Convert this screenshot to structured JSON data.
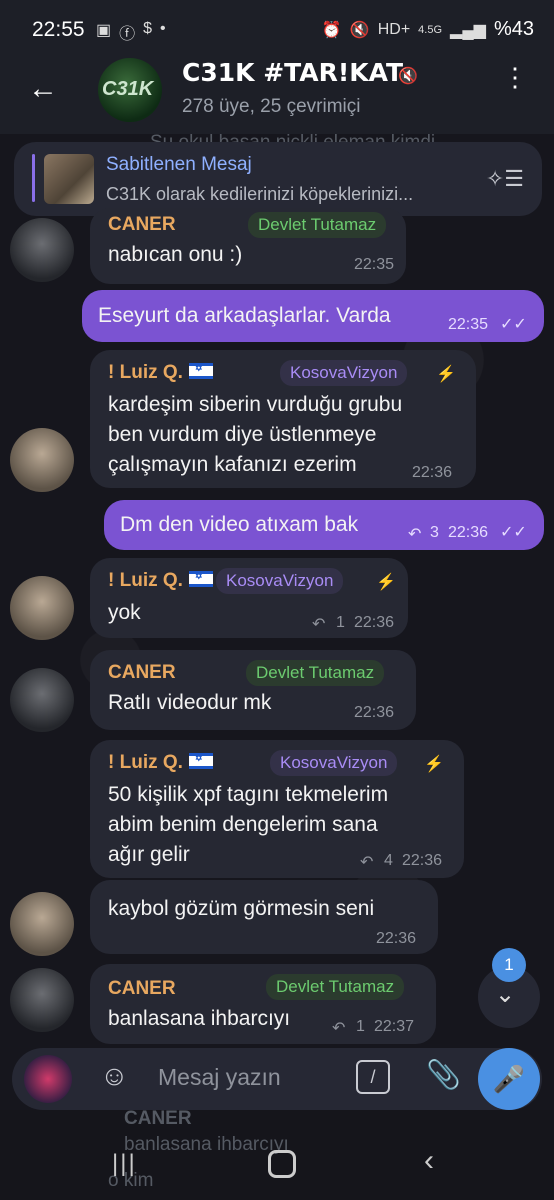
{
  "status": {
    "time": "22:55",
    "network": "4.5G",
    "battery": "%43"
  },
  "header": {
    "title": "C31K #TAR!KAT",
    "subtitle": "278 üye, 25 çevrimiçi",
    "avatar_text": "C31K"
  },
  "pinned": {
    "title": "Sabitlenen Mesaj",
    "text": "C31K olarak kedilerinizi köpeklerinizi..."
  },
  "overlap_text": "Şu okul başan nickli eleman kimdi",
  "messages": [
    {
      "sender": "CANER",
      "tag": "Devlet Tutamaz",
      "text": "nabıcan onu :)",
      "time": "22:35"
    },
    {
      "text": "Eseyurt da arkadaşlarlar. Varda",
      "time": "22:35"
    },
    {
      "sender": "! Luiz Q.",
      "tag": "KosovaVizyon",
      "text": [
        "kardeşim siberin vurduğu grubu",
        "ben vurdum diye üstlenmeye",
        "çalışmayın kafanızı ezerim"
      ],
      "time": "22:36"
    },
    {
      "text": "Dm den video atıxam bak",
      "replies": "3",
      "time": "22:36"
    },
    {
      "sender": "! Luiz Q.",
      "tag": "KosovaVizyon",
      "text": "yok",
      "replies": "1",
      "time": "22:36"
    },
    {
      "sender": "CANER",
      "tag": "Devlet Tutamaz",
      "text": "Ratlı videodur mk",
      "time": "22:36"
    },
    {
      "sender": "! Luiz Q.",
      "tag": "KosovaVizyon",
      "text": [
        "50 kişilik xpf tagını tekmelerim",
        "abim benim dengelerim sana",
        "ağır gelir"
      ],
      "replies": "4",
      "time": "22:36"
    },
    {
      "text": "kaybol gözüm görmesin seni",
      "time": "22:36"
    },
    {
      "sender": "CANER",
      "tag": "Devlet Tutamaz",
      "text": "banlasana ihbarcıyı",
      "replies": "1",
      "time": "22:37"
    }
  ],
  "unread_badge": "1",
  "input": {
    "placeholder": "Mesaj yazın"
  },
  "ghost": {
    "sender": "CANER",
    "text": "banlasana ihbarcıyı",
    "text2": "o kim"
  }
}
